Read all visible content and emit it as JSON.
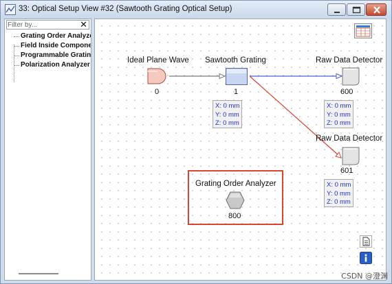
{
  "window": {
    "title": "33: Optical Setup View #32 (Sawtooth Grating Optical Setup)"
  },
  "left_panel": {
    "filter_placeholder": "Filter by...",
    "filter_clear": "✕",
    "tree_items": [
      {
        "label": "Grating Order Analyzer"
      },
      {
        "label": "Field Inside Component"
      },
      {
        "label": "Programmable Grating"
      },
      {
        "label": "Polarization Analyzer"
      }
    ]
  },
  "canvas": {
    "nodes": {
      "wave": {
        "label": "Ideal Plane Wave",
        "number": "0"
      },
      "grating": {
        "label": "Sawtooth Grating",
        "number": "1",
        "pos": {
          "x": "X: 0 mm",
          "y": "Y: 0 mm",
          "z": "Z: 0 mm"
        }
      },
      "detector1": {
        "label": "Raw Data Detector",
        "number": "600",
        "pos": {
          "x": "X: 0 mm",
          "y": "Y: 0 mm",
          "z": "Z: 0 mm"
        }
      },
      "detector2": {
        "label": "Raw Data Detector",
        "number": "601",
        "pos": {
          "x": "X: 0 mm",
          "y": "Y: 0 mm",
          "z": "Z: 0 mm"
        }
      },
      "analyzer": {
        "label": "Grating Order Analyzer",
        "number": "800"
      }
    }
  },
  "colors": {
    "highlight": "#d9442d",
    "link_blue": "#4a5cd6",
    "link_red": "#d9442d",
    "position_text": "#1f2fd8"
  },
  "watermark": "CSDN @澄渊"
}
